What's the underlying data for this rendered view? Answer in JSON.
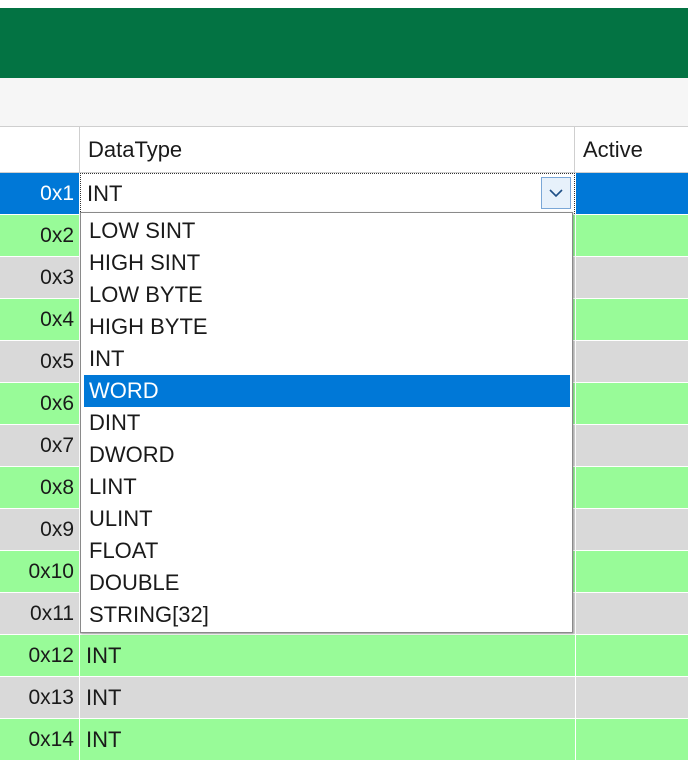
{
  "header": {
    "datatype_label": "DataType",
    "active_label": "Active"
  },
  "editor": {
    "value": "INT",
    "dropdown_icon": "chevron-down-icon"
  },
  "dropdown": {
    "options": [
      "LOW SINT",
      "HIGH SINT",
      "LOW BYTE",
      "HIGH BYTE",
      "INT",
      "WORD",
      "DINT",
      "DWORD",
      "LINT",
      "ULINT",
      "FLOAT",
      "DOUBLE",
      "STRING[32]"
    ],
    "highlighted": "WORD"
  },
  "rows": [
    {
      "index": "0x1",
      "datatype": "INT",
      "style": "selected"
    },
    {
      "index": "0x2",
      "datatype": "",
      "style": "green"
    },
    {
      "index": "0x3",
      "datatype": "",
      "style": "gray"
    },
    {
      "index": "0x4",
      "datatype": "",
      "style": "green"
    },
    {
      "index": "0x5",
      "datatype": "",
      "style": "gray"
    },
    {
      "index": "0x6",
      "datatype": "",
      "style": "green"
    },
    {
      "index": "0x7",
      "datatype": "",
      "style": "gray"
    },
    {
      "index": "0x8",
      "datatype": "",
      "style": "green"
    },
    {
      "index": "0x9",
      "datatype": "",
      "style": "gray"
    },
    {
      "index": "0x10",
      "datatype": "",
      "style": "green"
    },
    {
      "index": "0x11",
      "datatype": "",
      "style": "gray"
    },
    {
      "index": "0x12",
      "datatype": "INT",
      "style": "green"
    },
    {
      "index": "0x13",
      "datatype": "INT",
      "style": "gray"
    },
    {
      "index": "0x14",
      "datatype": "INT",
      "style": "green"
    }
  ],
  "colors": {
    "title_bar": "#037343",
    "row_green": "#98fb98",
    "row_gray": "#d9d9d9",
    "selection": "#0078d7"
  }
}
